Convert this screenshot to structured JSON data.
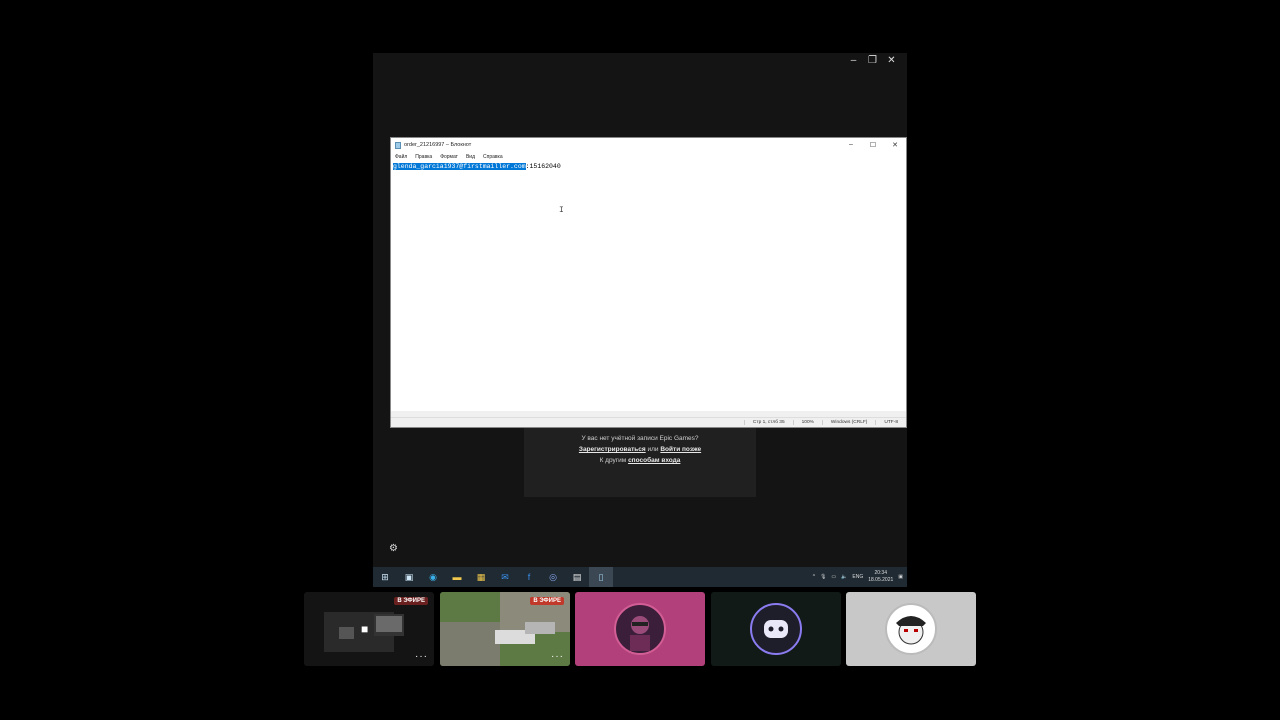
{
  "screen": {
    "window_controls": [
      "–",
      "❐",
      "✕"
    ]
  },
  "notepad": {
    "title": "order_21216997 – Блокнот",
    "menu": [
      "Файл",
      "Правка",
      "Формат",
      "Вид",
      "Справка"
    ],
    "content_selected": "glenda_garcia1937@firstmailler.com",
    "content_rest": ":15162040",
    "status": {
      "position": "Стр 1, стлб 35",
      "zoom": "100%",
      "line_ending": "Windows (CRLF)",
      "encoding": "UTF-8"
    }
  },
  "epic": {
    "no_account": "У вас нет учётной записи Epic Games?",
    "register": "Зарегистрироваться",
    "or": "или",
    "login_later": "Войти позже",
    "other_methods_prefix": "К другим",
    "other_methods_link": "способам входа"
  },
  "taskbar": {
    "lang": "ENG",
    "time": "20:34",
    "date": "18.05.2021"
  },
  "tiles": [
    {
      "live": "В ЭФИРЕ"
    },
    {
      "live": "В ЭФИРЕ"
    }
  ],
  "colors": {
    "selection": "#0078d7",
    "live_badge": "#c0392b",
    "tile_pink": "#b2407a",
    "tile_dark": "#121a18",
    "tile_gray": "#c8c8c8"
  }
}
